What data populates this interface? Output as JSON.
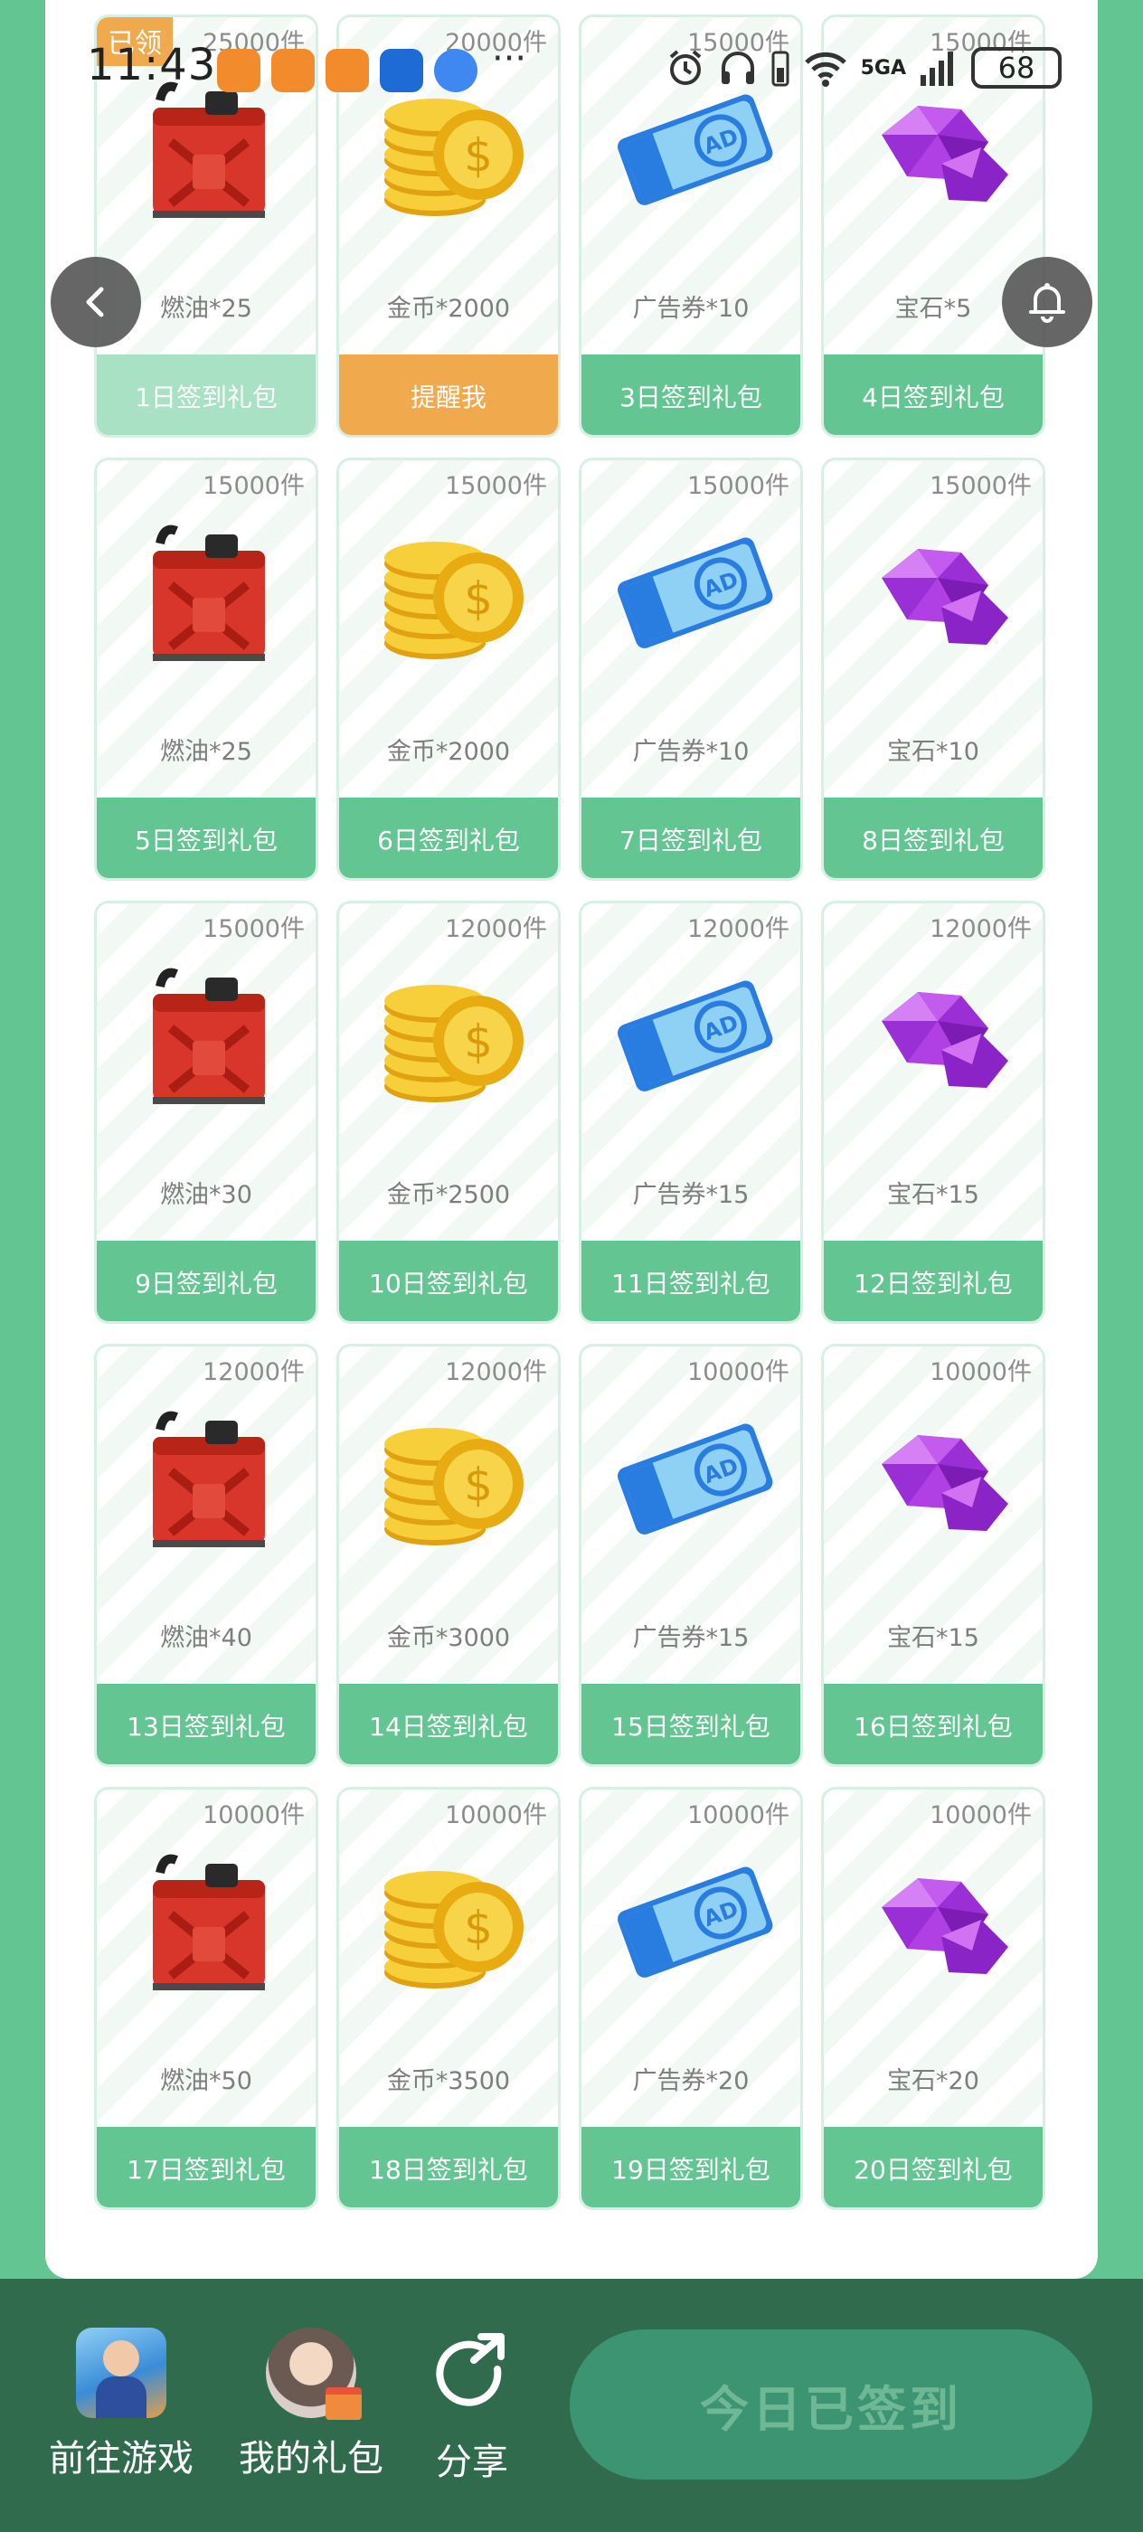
{
  "status_bar": {
    "time": "11:43",
    "more": "···",
    "network": "5GA",
    "battery": "68"
  },
  "claimed_badge": "已领",
  "cards": [
    {
      "stock": "25000件",
      "item": "燃油*25",
      "button": "1日签到礼包",
      "icon": "fuel-can-icon",
      "state": "done"
    },
    {
      "stock": "20000件",
      "item": "金币*2000",
      "button": "提醒我",
      "icon": "gold-coins-icon",
      "state": "remind"
    },
    {
      "stock": "15000件",
      "item": "广告券*10",
      "button": "3日签到礼包",
      "icon": "ad-ticket-icon",
      "state": "normal"
    },
    {
      "stock": "15000件",
      "item": "宝石*5",
      "button": "4日签到礼包",
      "icon": "gem-icon",
      "state": "normal"
    },
    {
      "stock": "15000件",
      "item": "燃油*25",
      "button": "5日签到礼包",
      "icon": "fuel-can-icon",
      "state": "normal"
    },
    {
      "stock": "15000件",
      "item": "金币*2000",
      "button": "6日签到礼包",
      "icon": "gold-coins-icon",
      "state": "normal"
    },
    {
      "stock": "15000件",
      "item": "广告券*10",
      "button": "7日签到礼包",
      "icon": "ad-ticket-icon",
      "state": "normal"
    },
    {
      "stock": "15000件",
      "item": "宝石*10",
      "button": "8日签到礼包",
      "icon": "gem-icon",
      "state": "normal"
    },
    {
      "stock": "15000件",
      "item": "燃油*30",
      "button": "9日签到礼包",
      "icon": "fuel-can-icon",
      "state": "normal"
    },
    {
      "stock": "12000件",
      "item": "金币*2500",
      "button": "10日签到礼包",
      "icon": "gold-coins-icon",
      "state": "normal"
    },
    {
      "stock": "12000件",
      "item": "广告券*15",
      "button": "11日签到礼包",
      "icon": "ad-ticket-icon",
      "state": "normal"
    },
    {
      "stock": "12000件",
      "item": "宝石*15",
      "button": "12日签到礼包",
      "icon": "gem-icon",
      "state": "normal"
    },
    {
      "stock": "12000件",
      "item": "燃油*40",
      "button": "13日签到礼包",
      "icon": "fuel-can-icon",
      "state": "normal"
    },
    {
      "stock": "12000件",
      "item": "金币*3000",
      "button": "14日签到礼包",
      "icon": "gold-coins-icon",
      "state": "normal"
    },
    {
      "stock": "10000件",
      "item": "广告券*15",
      "button": "15日签到礼包",
      "icon": "ad-ticket-icon",
      "state": "normal"
    },
    {
      "stock": "10000件",
      "item": "宝石*15",
      "button": "16日签到礼包",
      "icon": "gem-icon",
      "state": "normal"
    },
    {
      "stock": "10000件",
      "item": "燃油*50",
      "button": "17日签到礼包",
      "icon": "fuel-can-icon",
      "state": "normal"
    },
    {
      "stock": "10000件",
      "item": "金币*3500",
      "button": "18日签到礼包",
      "icon": "gold-coins-icon",
      "state": "normal"
    },
    {
      "stock": "10000件",
      "item": "广告券*20",
      "button": "19日签到礼包",
      "icon": "ad-ticket-icon",
      "state": "normal"
    },
    {
      "stock": "10000件",
      "item": "宝石*20",
      "button": "20日签到礼包",
      "icon": "gem-icon",
      "state": "normal"
    }
  ],
  "bottom_nav": {
    "go_game": "前往游戏",
    "my_gifts": "我的礼包",
    "share": "分享",
    "signed_today": "今日已签到"
  },
  "colors": {
    "accent_green": "#63c591",
    "bottom_bar": "#2f6b4c",
    "remind_orange": "#f0a94c"
  }
}
